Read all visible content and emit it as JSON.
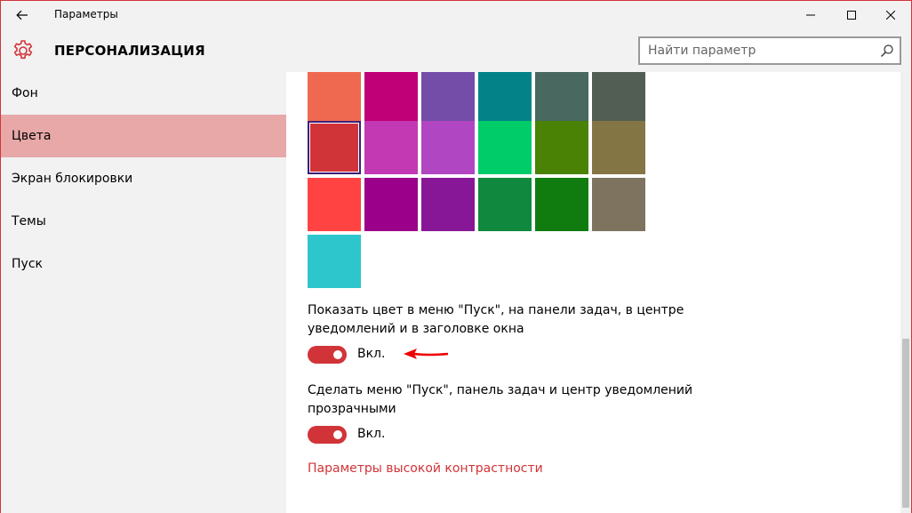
{
  "window": {
    "title": "Параметры"
  },
  "header": {
    "title": "ПЕРСОНАЛИЗАЦИЯ",
    "search_placeholder": "Найти параметр"
  },
  "sidebar": {
    "items": [
      {
        "label": "Фон",
        "active": false
      },
      {
        "label": "Цвета",
        "active": true
      },
      {
        "label": "Экран блокировки",
        "active": false
      },
      {
        "label": "Темы",
        "active": false
      },
      {
        "label": "Пуск",
        "active": false
      }
    ]
  },
  "palette": {
    "rows": [
      [
        "#ef6950",
        "#bf0077",
        "#744da9",
        "#038387",
        "#486860",
        "#525e54"
      ],
      [
        "#d13438",
        "#c239b3",
        "#b146c2",
        "#00cc6a",
        "#498205",
        "#847545"
      ],
      [
        "#ff4343",
        "#9a0089",
        "#881798",
        "#10893e",
        "#107c10",
        "#7e735f"
      ],
      [
        "#2ec6cd"
      ]
    ],
    "selected": "#d13438"
  },
  "settings": {
    "show_color_text": "Показать цвет в меню \"Пуск\", на панели задач, в центре уведомлений и в заголовке окна",
    "show_color_state": "Вкл.",
    "transparency_text": "Сделать меню \"Пуск\", панель задач и центр уведомлений прозрачными",
    "transparency_state": "Вкл.",
    "high_contrast_link": "Параметры высокой контрастности"
  },
  "colors": {
    "accent": "#d13438",
    "nav_active": "#e8a8a8"
  }
}
